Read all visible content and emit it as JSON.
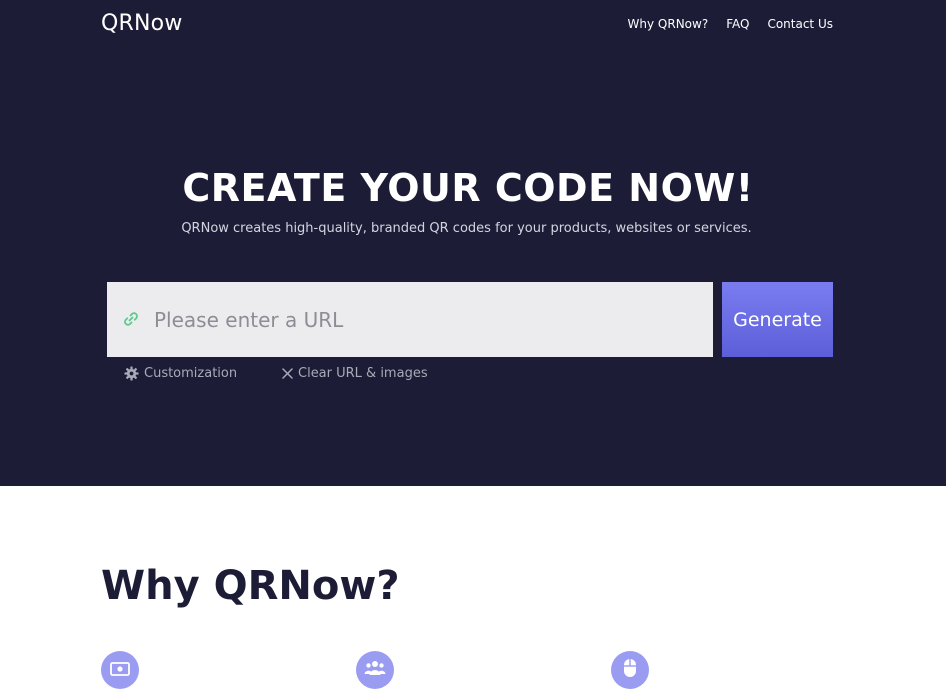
{
  "header": {
    "logo": "QRNow",
    "nav": [
      "Why QRNow?",
      "FAQ",
      "Contact Us"
    ]
  },
  "hero": {
    "title": "CREATE YOUR CODE NOW!",
    "subtitle": "QRNow creates high-quality, branded QR codes for your products, websites or services.",
    "url_input": {
      "placeholder": "Please enter a URL",
      "value": ""
    },
    "generate_label": "Generate",
    "options": {
      "customization": "Customization",
      "clear": "Clear URL & images"
    }
  },
  "why": {
    "title": "Why QRNow?",
    "feature_icons": [
      "money-icon",
      "users-icon",
      "mouse-icon"
    ]
  },
  "colors": {
    "hero_bg": "#1c1c37",
    "accent": "#6366f1",
    "icon_circle": "#9a9cf2",
    "link_icon": "#5cc98c"
  }
}
